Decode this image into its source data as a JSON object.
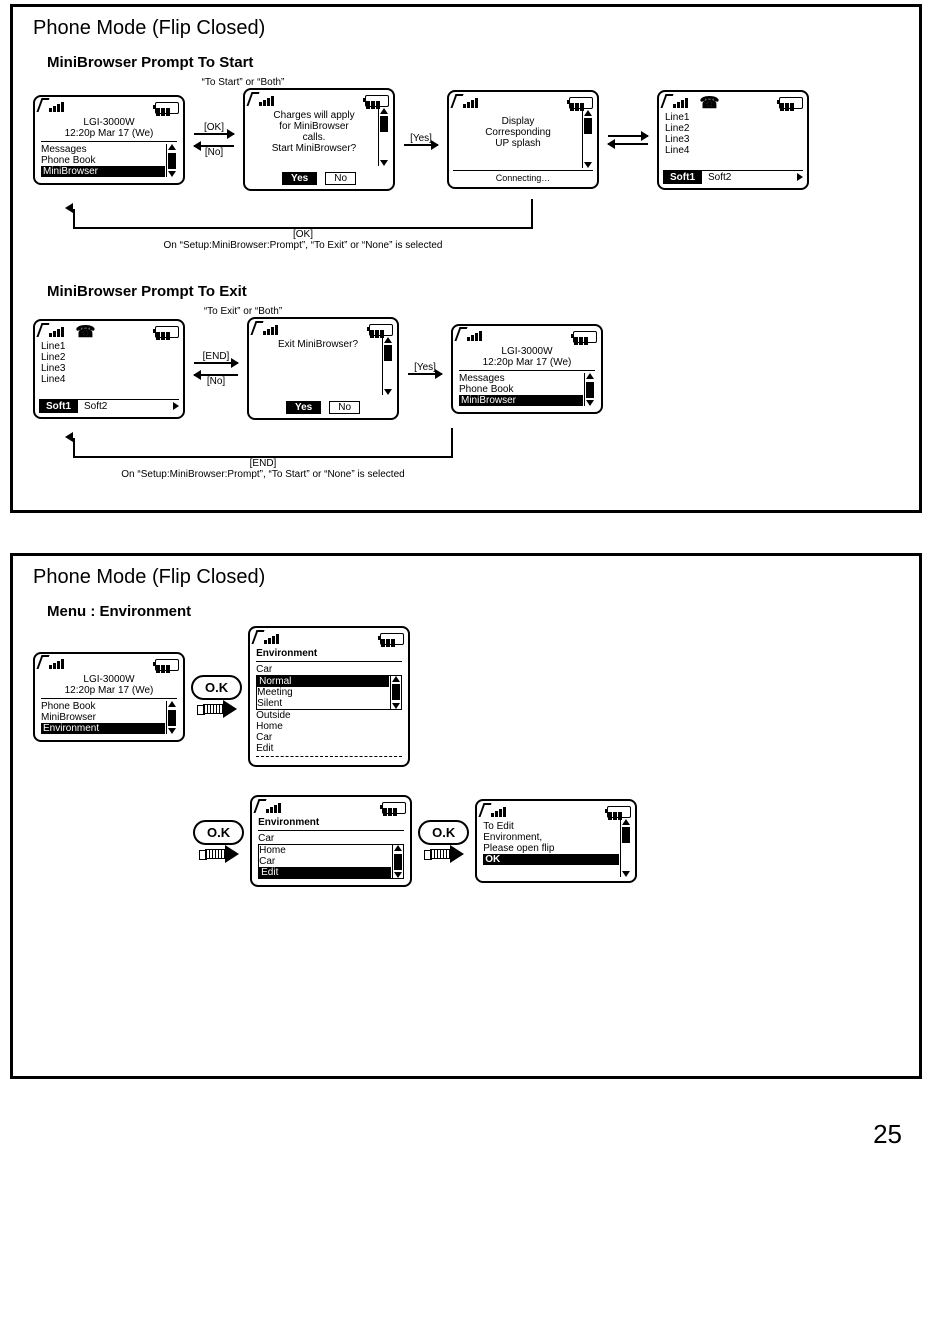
{
  "pageNumber": "25",
  "panel1": {
    "title": "Phone Mode (Flip Closed)",
    "sectA": {
      "heading": "MiniBrowser Prompt To Start",
      "topLabel": "“To Start” or “Both”",
      "okLabel": "[OK]",
      "noLabel": "[No]",
      "yesLabel": "[Yes]",
      "screen1": {
        "title": "LGI-3000W",
        "time": "12:20p Mar 17 (We)",
        "m1": "Messages",
        "m2": "Phone Book",
        "m3": "MiniBrowser"
      },
      "screen2": {
        "l1": "Charges will apply",
        "l2": "for MiniBrowser",
        "l3": "calls.",
        "l4": "Start MiniBrowser?",
        "yes": "Yes",
        "no": "No"
      },
      "screen3": {
        "l1": "Display",
        "l2": "Corresponding",
        "l3": "UP splash",
        "foot": "Connecting…"
      },
      "screen4": {
        "l1": "Line1",
        "l2": "Line2",
        "l3": "Line3",
        "l4": "Line4",
        "s1": "Soft1",
        "s2": "Soft2"
      },
      "lowOk": "[OK]",
      "lowNote": "On “Setup:MiniBrowser:Prompt”, “To Exit” or “None” is selected"
    },
    "sectB": {
      "heading": "MiniBrowser Prompt To Exit",
      "topLabel": "“To Exit” or “Both”",
      "endLabel": "[END]",
      "noLabel": "[No]",
      "yesLabel": "[Yes]",
      "screen1": {
        "l1": "Line1",
        "l2": "Line2",
        "l3": "Line3",
        "l4": "Line4",
        "s1": "Soft1",
        "s2": "Soft2"
      },
      "screen2": {
        "l1": "Exit MiniBrowser?",
        "yes": "Yes",
        "no": "No"
      },
      "screen3": {
        "title": "LGI-3000W",
        "time": "12:20p Mar 17 (We)",
        "m1": "Messages",
        "m2": "Phone Book",
        "m3": "MiniBrowser"
      },
      "lowEnd": "[END]",
      "lowNote": "On “Setup:MiniBrowser:Prompt”,  “To Start” or “None” is selected"
    }
  },
  "panel2": {
    "title": "Phone Mode (Flip Closed)",
    "heading": "Menu : Environment",
    "ok": "O.K",
    "screen1": {
      "title": "LGI-3000W",
      "time": "12:20p Mar 17 (We)",
      "m1": "Phone Book",
      "m2": "MiniBrowser",
      "m3": "Environment"
    },
    "screen2": {
      "hdr": "Environment",
      "cur": "Car",
      "i1": "Normal",
      "i2": "Meeting",
      "i3": "Silent",
      "i4": "Outside",
      "i5": "Home",
      "i6": "Car",
      "i7": "Edit"
    },
    "screen3": {
      "hdr": "Environment",
      "cur": "Car",
      "i1": "Home",
      "i2": "Car",
      "i3": "Edit"
    },
    "screen4": {
      "l1": "To Edit",
      "l2": "Environment,",
      "l3": "Please open flip",
      "ok": "OK"
    }
  }
}
